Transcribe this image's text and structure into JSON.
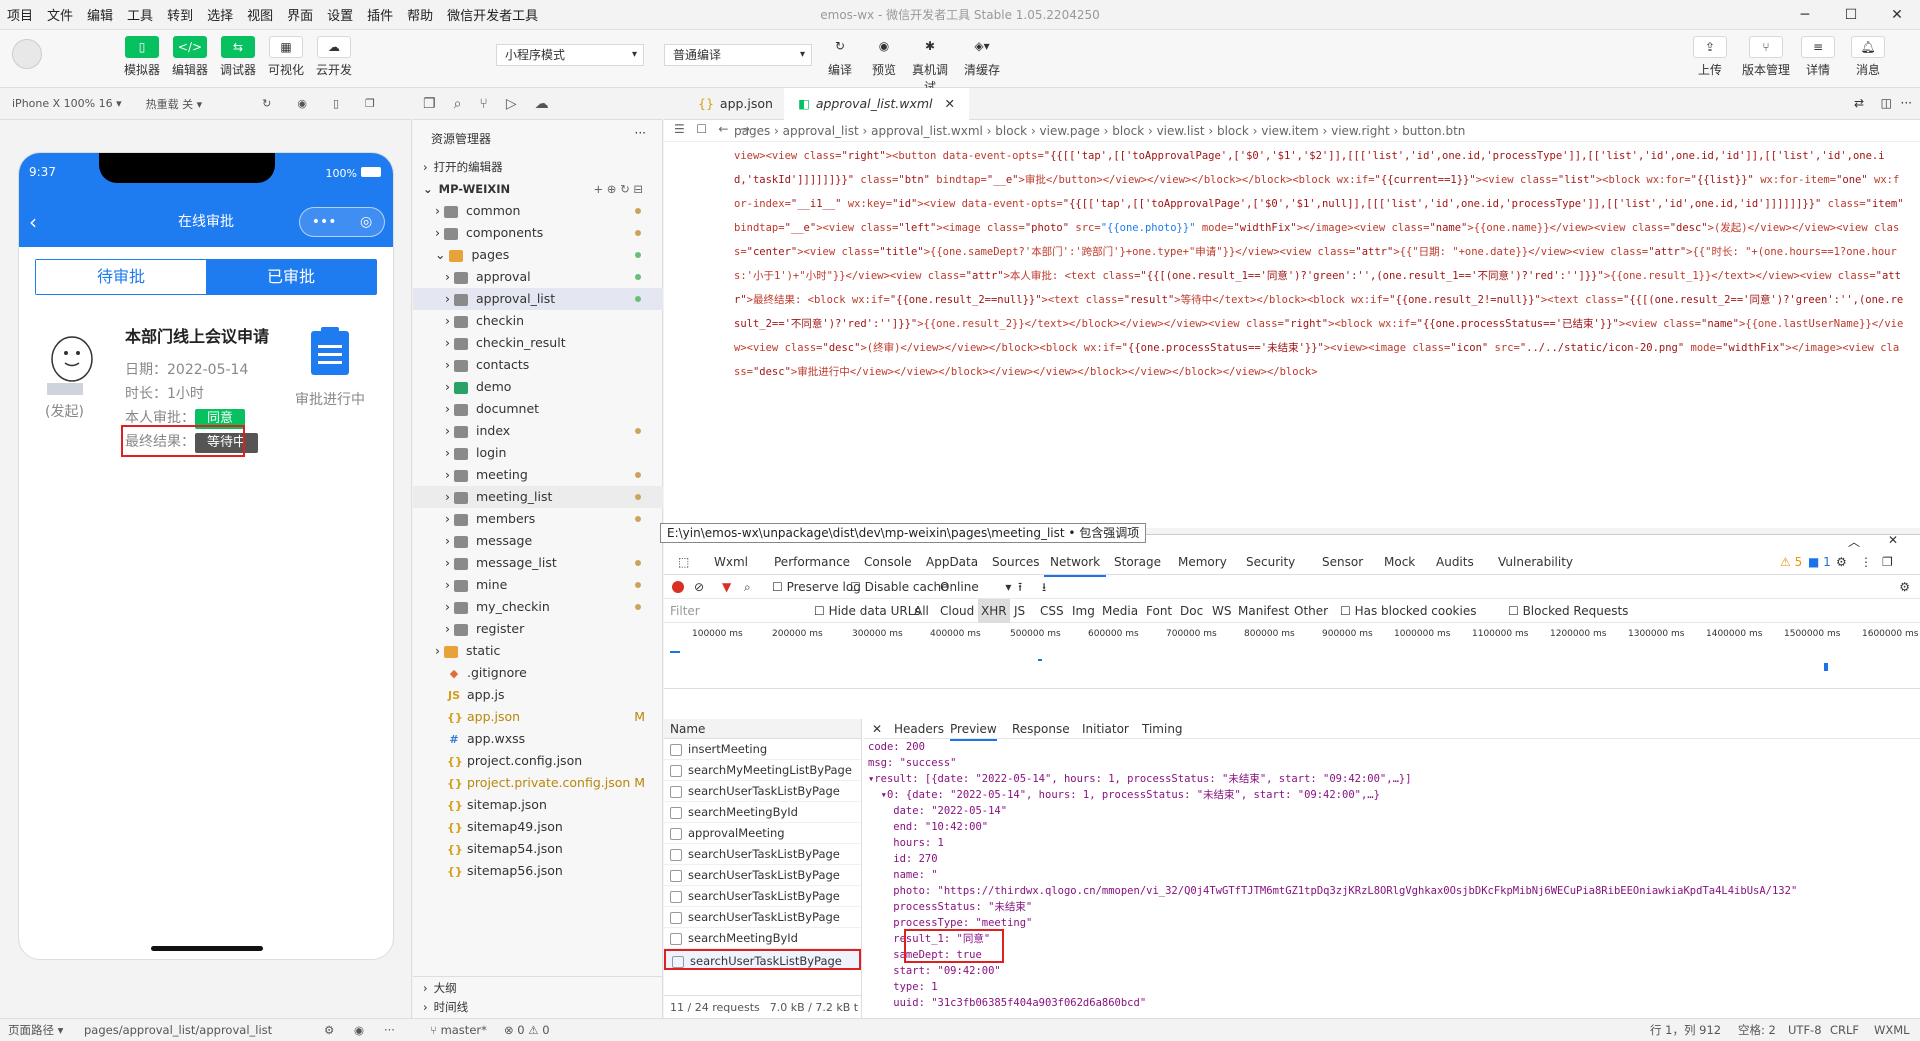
{
  "menu": [
    "项目",
    "文件",
    "编辑",
    "工具",
    "转到",
    "选择",
    "视图",
    "界面",
    "设置",
    "插件",
    "帮助",
    "微信开发者工具"
  ],
  "window_title": "emos-wx - 微信开发者工具 Stable 1.05.2204250",
  "toolbar": {
    "simulator": "模拟器",
    "editor": "编辑器",
    "debugger": "调试器",
    "visual": "可视化",
    "cloud": "云开发",
    "mode_select": "小程序模式",
    "compile_select": "普通编译",
    "compile": "编译",
    "preview": "预览",
    "real_debug": "真机调试",
    "clear_cache": "清缓存",
    "upload": "上传",
    "version": "版本管理",
    "detail": "详情",
    "message": "消息"
  },
  "sim_bar": {
    "device": "iPhone X 100% 16 ▾",
    "hotreload": "热重载 关 ▾"
  },
  "phone": {
    "time": "9:37",
    "battery": "100%",
    "nav_title": "在线审批",
    "tab_pending": "待审批",
    "tab_done": "已审批",
    "card_title": "本部门线上会议申请",
    "date": "日期：2022-05-14",
    "duration": "时长：1小时",
    "dept_label": "本人审批：",
    "dept_result": "同意",
    "final_label": "最终结果：",
    "final_result": "等待中",
    "initiator": "(发起)",
    "status_text": "审批进行中"
  },
  "explorer": {
    "title": "资源管理器",
    "open_editors": "打开的编辑器",
    "root": "MP-WEIXIN",
    "items": [
      "common",
      "components",
      "pages",
      "approval",
      "approval_list",
      "checkin",
      "checkin_result",
      "contacts",
      "demo",
      "documnet",
      "index",
      "login",
      "meeting",
      "meeting_list",
      "members",
      "message",
      "message_list",
      "mine",
      "my_checkin",
      "register",
      "static",
      ".gitignore",
      "app.js",
      "app.json",
      "app.wxss",
      "project.config.json",
      "project.private.config.json",
      "sitemap.json",
      "sitemap49.json",
      "sitemap54.json",
      "sitemap56.json"
    ],
    "outline": "大纲",
    "timeline": "时间线"
  },
  "editor": {
    "tab1": "app.json",
    "tab2": "approval_list.wxml",
    "breadcrumb": "pages  ›  approval_list  ›  approval_list.wxml  ›  block  ›  view.page  ›  block  ›  view.list  ›  block  ›  view.item  ›  view.right  ›  button.btn",
    "tooltip": "E:\\yin\\emos-wx\\unpackage\\dist\\dev\\mp-weixin\\pages\\meeting_list • 包含强调项"
  },
  "devtools": {
    "tabs": [
      "Wxml",
      "Performance",
      "Console",
      "AppData",
      "Sources",
      "Network",
      "Storage",
      "Memory",
      "Security",
      "Sensor",
      "Mock",
      "Audits",
      "Vulnerability"
    ],
    "warn": "5",
    "info": "1",
    "preserve_log": "Preserve log",
    "disable_cache": "Disable cache",
    "online": "Online",
    "filter": "Filter",
    "hide_data": "Hide data URLs",
    "filters": [
      "All",
      "Cloud",
      "XHR",
      "JS",
      "CSS",
      "Img",
      "Media",
      "Font",
      "Doc",
      "WS",
      "Manifest",
      "Other"
    ],
    "blocked_cookies": "Has blocked cookies",
    "blocked_requests": "Blocked Requests",
    "timeline": [
      "100000 ms",
      "200000 ms",
      "300000 ms",
      "400000 ms",
      "500000 ms",
      "600000 ms",
      "700000 ms",
      "800000 ms",
      "900000 ms",
      "1000000 ms",
      "1100000 ms",
      "1200000 ms",
      "1300000 ms",
      "1400000 ms",
      "1500000 ms",
      "1600000 ms"
    ],
    "name_header": "Name",
    "requests": [
      "insertMeeting",
      "searchMyMeetingListByPage",
      "searchUserTaskListByPage",
      "searchMeetingById",
      "approvalMeeting",
      "searchUserTaskListByPage",
      "searchUserTaskListByPage",
      "searchUserTaskListByPage",
      "searchUserTaskListByPage",
      "searchMeetingById",
      "searchUserTaskListByPage"
    ],
    "req_footer": "11 / 24 requests",
    "size_footer": "7.0 kB / 7.2 kB t",
    "detail_tabs": [
      "Headers",
      "Preview",
      "Response",
      "Initiator",
      "Timing"
    ],
    "preview_lines": [
      "code: 200",
      "msg: \"success\"",
      "▾result: [{date: \"2022-05-14\", hours: 1, processStatus: \"未结束\", start: \"09:42:00\",…}]",
      "  ▾0: {date: \"2022-05-14\", hours: 1, processStatus: \"未结束\", start: \"09:42:00\",…}",
      "    date: \"2022-05-14\"",
      "    end: \"10:42:00\"",
      "    hours: 1",
      "    id: 270",
      "    name: \"",
      "    photo: \"https://thirdwx.qlogo.cn/mmopen/vi_32/Q0j4TwGTfTJTM6mtGZ1tpDq3zjKRzL8ORlgVghkax0OsjbDKcFkpMibNj6WECuPia8RibEEOniawkiaKpdTa4L4ibUsA/132\"",
      "    processStatus: \"未结束\"",
      "    processType: \"meeting\"",
      "    result_1: \"同意\"",
      "    sameDept: true",
      "    start: \"09:42:00\"",
      "    type: 1",
      "    uuid: \"31c3fb06385f404a903f062d6a860bcd\""
    ]
  },
  "statusbar": {
    "path_label": "页面路径 ▾",
    "path": "pages/approval_list/approval_list",
    "branch": "master*",
    "errors": "⊗ 0 ⚠ 0",
    "pos": "行 1，列 912",
    "spaces": "空格: 2",
    "enc": "UTF-8",
    "eol": "CRLF",
    "lang": "WXML"
  }
}
